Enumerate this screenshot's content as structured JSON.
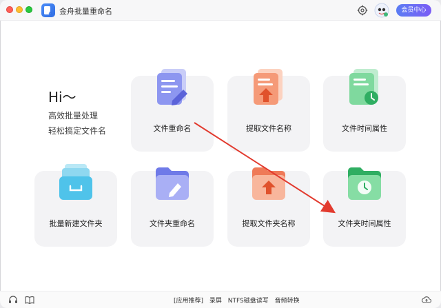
{
  "app": {
    "title": "金舟批量重命名",
    "member_label": "会员中心"
  },
  "greeting": {
    "hi": "Hi～",
    "line1": "高效批量处理",
    "line2": "轻松搞定文件名"
  },
  "cards": [
    {
      "label": "文件重命名",
      "icon": "file-rename-icon"
    },
    {
      "label": "提取文件名称",
      "icon": "extract-filename-icon"
    },
    {
      "label": "文件时间属性",
      "icon": "file-time-icon"
    },
    {
      "label": "批量新建文件夹",
      "icon": "batch-new-folder-icon"
    },
    {
      "label": "文件夹重命名",
      "icon": "folder-rename-icon"
    },
    {
      "label": "提取文件夹名称",
      "icon": "extract-foldername-icon"
    },
    {
      "label": "文件夹时间属性",
      "icon": "folder-time-icon"
    }
  ],
  "footer": {
    "recommend": "[应用推荐]",
    "links": [
      "录屏",
      "NTFS磁盘读写",
      "音频转换"
    ]
  },
  "colors": {
    "accent": "#5a7cf3",
    "arrow": "#e23a2e"
  }
}
